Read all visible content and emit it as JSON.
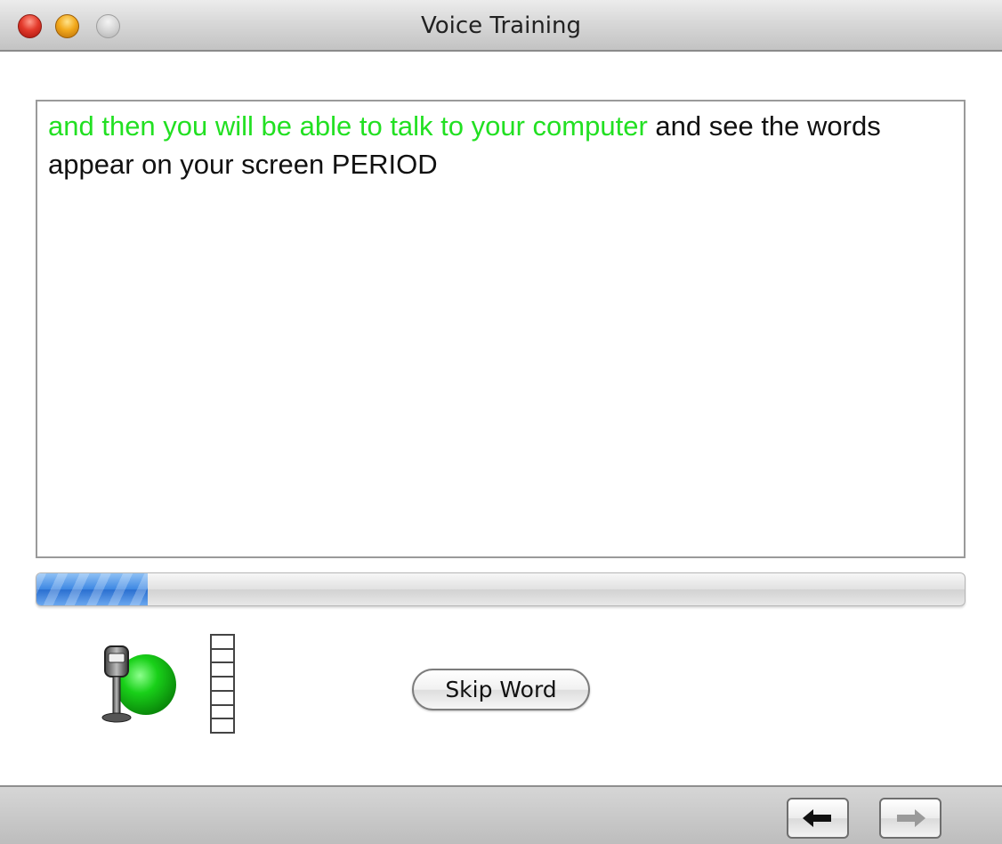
{
  "window": {
    "title": "Voice Training"
  },
  "training_text": {
    "spoken": "and then you will be able to talk to your computer",
    "remaining": " and see the words appear on your screen PERIOD"
  },
  "progress": {
    "fraction": 0.12
  },
  "controls": {
    "skip_word_label": "Skip Word"
  },
  "level_meter": {
    "segments": 7
  },
  "navigation": {
    "back_icon": "arrow-left-icon",
    "forward_icon": "arrow-right-icon"
  },
  "colors": {
    "spoken_text": "#22e022",
    "progress_fill": "#3d87e3",
    "mic_status": "#19c819"
  }
}
